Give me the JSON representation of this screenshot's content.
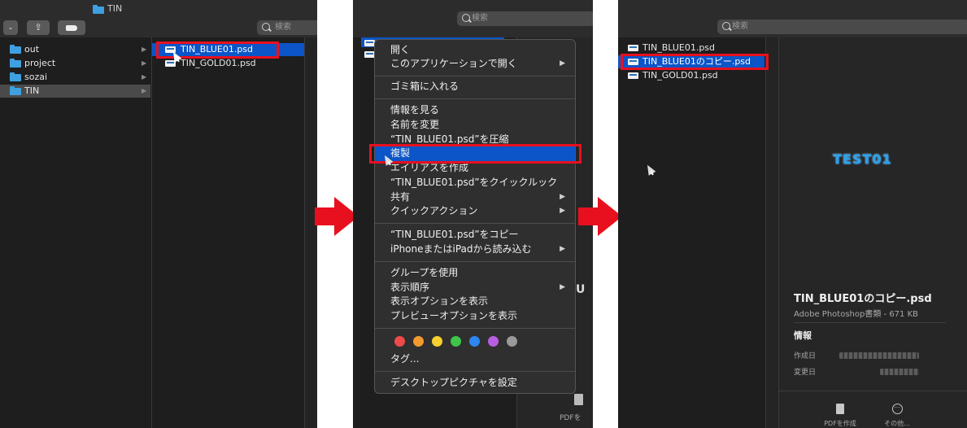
{
  "panel1": {
    "window_title": "TIN",
    "search_placeholder": "検索",
    "sidebar": [
      {
        "label": "out"
      },
      {
        "label": "project"
      },
      {
        "label": "sozai"
      },
      {
        "label": "TIN",
        "selected": true
      }
    ],
    "files": [
      {
        "label": "TIN_BLUE01.psd",
        "selected": true
      },
      {
        "label": "TIN_GOLD01.psd"
      }
    ]
  },
  "panel2": {
    "search_placeholder": "検索",
    "menu": {
      "items": [
        {
          "label": "開く"
        },
        {
          "label": "このアプリケーションで開く",
          "submenu": true
        },
        {
          "label": "ゴミ箱に入れる"
        },
        {
          "label": "情報を見る"
        },
        {
          "label": "名前を変更"
        },
        {
          "label": "“TIN_BLUE01.psd”を圧縮"
        },
        {
          "label": "複製",
          "highlighted": true
        },
        {
          "label": "エイリアスを作成"
        },
        {
          "label": "“TIN_BLUE01.psd”をクイックルック"
        },
        {
          "label": "共有",
          "submenu": true
        },
        {
          "label": "クイックアクション",
          "submenu": true
        },
        {
          "label": "“TIN_BLUE01.psd”をコピー"
        },
        {
          "label": "iPhoneまたはiPadから読み込む",
          "submenu": true
        },
        {
          "label": "グループを使用"
        },
        {
          "label": "表示順序",
          "submenu": true
        },
        {
          "label": "表示オプションを表示"
        },
        {
          "label": "プレビューオプションを表示"
        },
        {
          "label": "タグ..."
        },
        {
          "label": "デスクトップピクチャを設定"
        }
      ],
      "submenu_arrow": "▶",
      "tag_colors": [
        "#ef4a4a",
        "#f29a2e",
        "#f5d02f",
        "#3fc54a",
        "#2f86f0",
        "#b85ee0",
        "#9a9a9a"
      ]
    },
    "partial_right_text": "PDFを"
  },
  "panel3": {
    "search_placeholder": "検索",
    "files": [
      {
        "label": "TIN_BLUE01.psd"
      },
      {
        "label": "TIN_BLUE01のコピー.psd",
        "selected": true
      },
      {
        "label": "TIN_GOLD01.psd"
      }
    ],
    "preview": {
      "thumbnail_text": "TEST01",
      "filename": "TIN_BLUE01のコピー.psd",
      "kind": "Adobe Photoshop書類 - 671 KB",
      "info_heading": "情報",
      "created_label": "作成日",
      "modified_label": "変更日",
      "actions": [
        {
          "label": "PDFを作成",
          "icon": "pdf-doc-icon"
        },
        {
          "label": "その他...",
          "icon": "more-icon"
        }
      ]
    }
  },
  "colors": {
    "highlight": "#0b55c8",
    "annotation_red": "#e8101e",
    "finder_bg": "#1e1e1e"
  }
}
